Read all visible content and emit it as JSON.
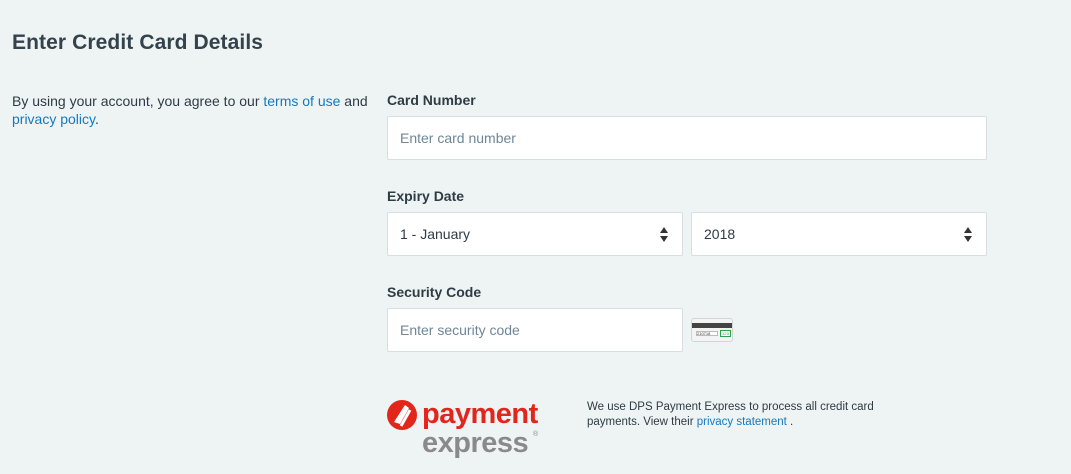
{
  "header": {
    "title": "Enter Credit Card Details"
  },
  "agreement": {
    "prefix": "By using your account, you agree to our ",
    "terms_link": "terms of use",
    "middle": " and ",
    "privacy_link": "privacy policy",
    "suffix": "."
  },
  "form": {
    "card_number": {
      "label": "Card Number",
      "placeholder": "Enter card number"
    },
    "expiry": {
      "label": "Expiry Date",
      "month_value": "1 - January",
      "year_value": "2018"
    },
    "security": {
      "label": "Security Code",
      "placeholder": "Enter security code"
    },
    "cvv_icon": {
      "name": "card-back-cvv-icon",
      "sig_text": "210718",
      "code_text": "123",
      "code_color": "#2da44e"
    }
  },
  "footer": {
    "logo": {
      "line1": "payment",
      "line2": "express",
      "brand_color": "#e2261c",
      "gray_color": "#8a8a8a"
    },
    "note_prefix": "We use DPS Payment Express to process all credit card payments. View their ",
    "privacy_link": "privacy statement",
    "note_suffix": " ."
  },
  "colors": {
    "background": "#eef3f3",
    "link": "#1479c3",
    "text": "#2f3b45"
  }
}
